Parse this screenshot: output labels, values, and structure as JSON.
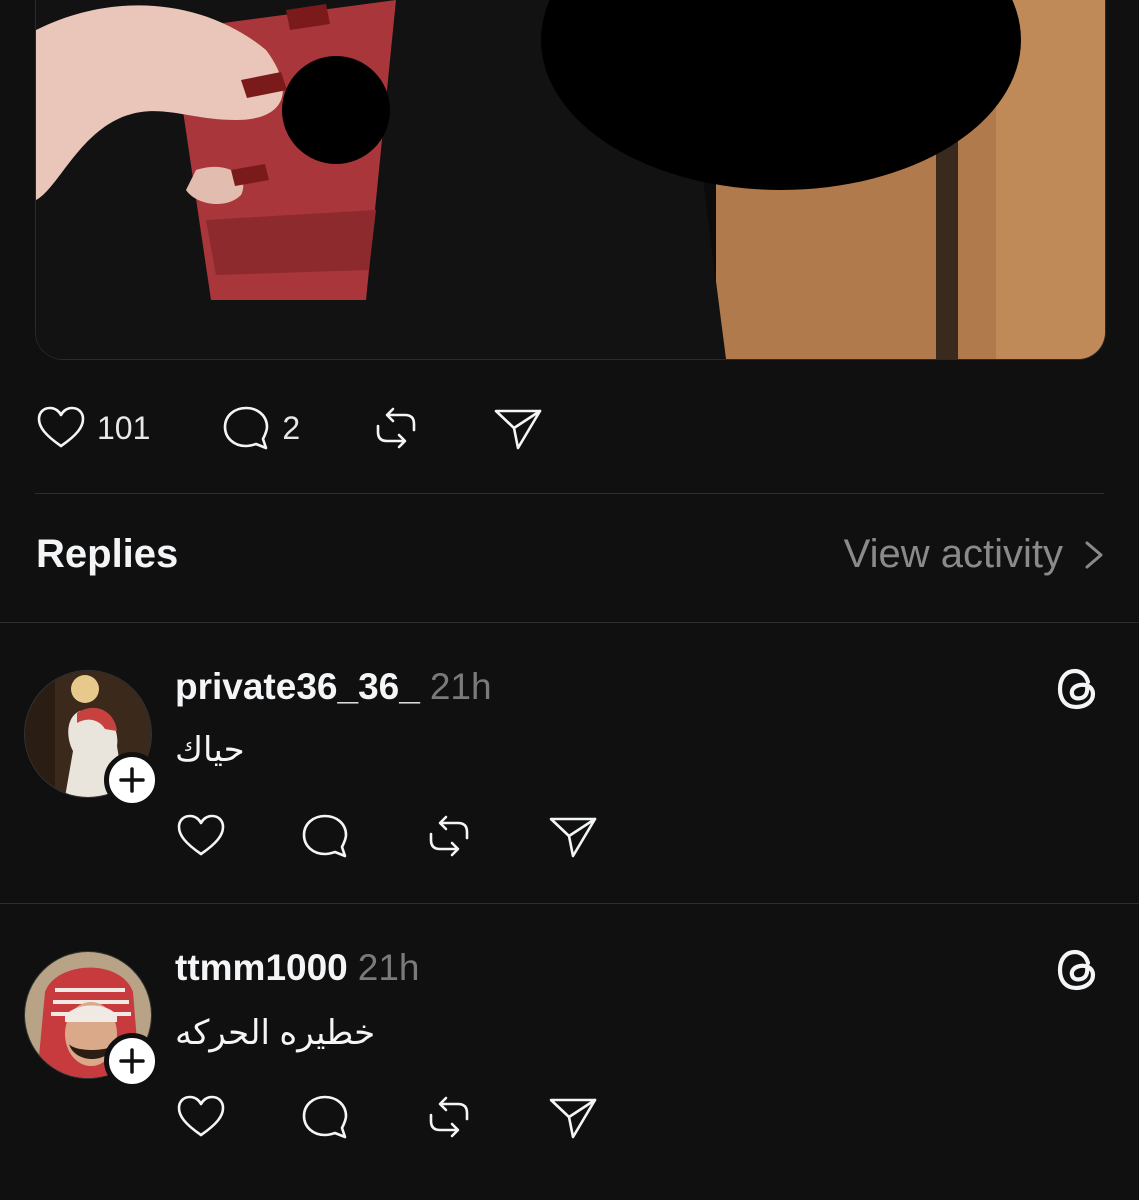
{
  "post": {
    "like_count": "101",
    "comment_count": "2"
  },
  "replies_section": {
    "title": "Replies",
    "view_activity_label": "View activity"
  },
  "replies": [
    {
      "username": "private36_36_",
      "time": "21h",
      "text": "حياك"
    },
    {
      "username": "ttmm1000",
      "time": "21h",
      "text": "خطيره الحركه"
    }
  ],
  "colors": {
    "background": "#101010",
    "text": "#f3f5f7",
    "muted": "#8a8a8a",
    "divider": "#2d2d2d"
  }
}
